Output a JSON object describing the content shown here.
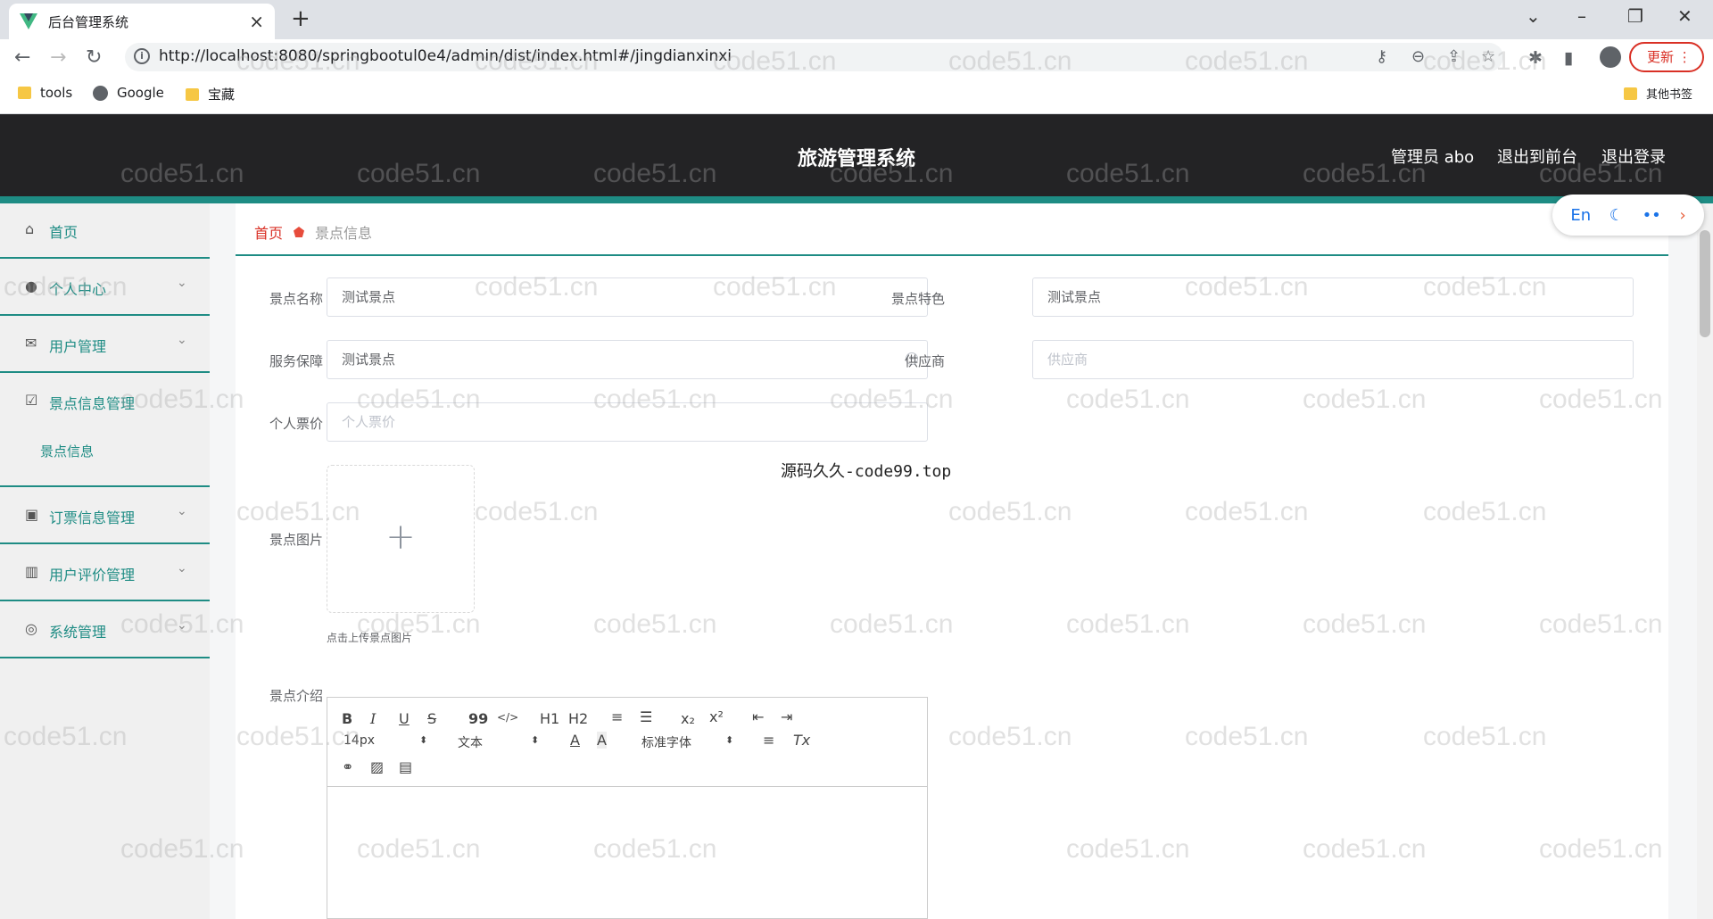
{
  "browser": {
    "tab_title": "后台管理系统",
    "new_tab": "+",
    "url": "http://localhost:8080/springbootul0e4/admin/dist/index.html#/jingdianxinxi",
    "update_label": "更新",
    "bookmarks": [
      "tools",
      "Google",
      "宝藏"
    ],
    "other_bookmarks": "其他书签"
  },
  "header": {
    "title": "旅游管理系统",
    "user": "管理员 abo",
    "to_front": "退出到前台",
    "logout": "退出登录"
  },
  "lang_widget": {
    "label": "En"
  },
  "sidebar": {
    "items": [
      {
        "label": "首页",
        "icon": "home-icon"
      },
      {
        "label": "个人中心",
        "icon": "user-icon"
      },
      {
        "label": "用户管理",
        "icon": "mail-icon"
      },
      {
        "label": "景点信息管理",
        "icon": "check-square-icon"
      },
      {
        "label": "订票信息管理",
        "icon": "ticket-icon"
      },
      {
        "label": "用户评价管理",
        "icon": "bar-chart-icon"
      },
      {
        "label": "系统管理",
        "icon": "settings-icon"
      }
    ],
    "sub_item": "景点信息"
  },
  "breadcrumb": {
    "home": "首页",
    "current": "景点信息"
  },
  "form": {
    "name_label": "景点名称",
    "name_value": "测试景点",
    "feature_label": "景点特色",
    "feature_value": "测试景点",
    "service_label": "服务保障",
    "service_value": "测试景点",
    "supplier_label": "供应商",
    "supplier_placeholder": "供应商",
    "price_label": "个人票价",
    "price_placeholder": "个人票价",
    "image_label": "景点图片",
    "upload_plus": "+",
    "upload_tip": "点击上传景点图片",
    "intro_label": "景点介绍"
  },
  "editor": {
    "bold": "B",
    "italic": "I",
    "underline": "U",
    "strike": "S",
    "quote": "99",
    "code": "</>",
    "h1": "H1",
    "h2": "H2",
    "ol": "≡",
    "ul": "☰",
    "sub": "x₂",
    "sup": "x²",
    "outdent": "⇤",
    "indent": "⇥",
    "size": "14px",
    "header_sel": "文本",
    "font_sel": "标准字体",
    "color": "A",
    "bg": "A",
    "align": "≡",
    "clean": "Tx"
  },
  "overlay_text": "源码久久-code99.top",
  "watermark": "code51.cn",
  "colors": {
    "accent": "#1e8c84",
    "header_bg": "#232325",
    "crumb_home": "#d93025"
  }
}
